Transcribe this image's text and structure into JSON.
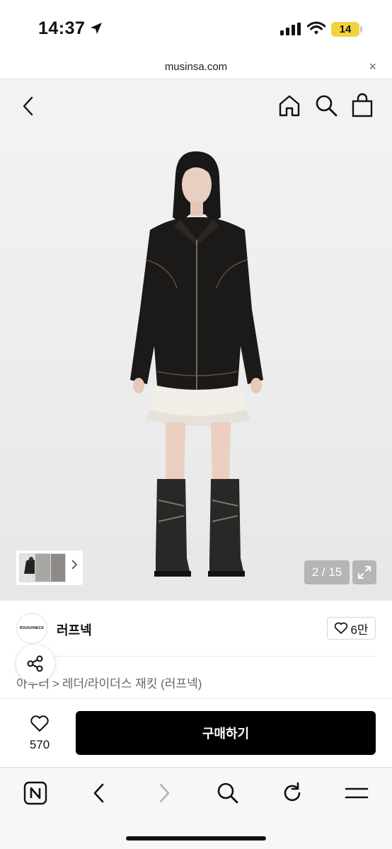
{
  "status": {
    "time": "14:37",
    "battery": "14"
  },
  "browser": {
    "url": "musinsa.com",
    "close_label": "×"
  },
  "gallery": {
    "counter": "2 / 15"
  },
  "brand": {
    "logo_text": "ROUGHNECK",
    "name": "러프넥",
    "like_count": "6만"
  },
  "breadcrumb": {
    "category": "아우터",
    "subcategory": "레더/라이더스 재킷 (러프넥)",
    "separator": ">"
  },
  "purchase": {
    "wish_count": "570",
    "buy_label": "구매하기"
  },
  "colors": {
    "buy_button": "#000000",
    "battery": "#f2d33d",
    "jacket": "#1c1a18"
  },
  "icons": [
    "back-chevron-icon",
    "home-icon",
    "search-icon",
    "shopping-bag-icon",
    "share-icon",
    "heart-icon",
    "naver-icon",
    "refresh-icon",
    "menu-icon",
    "expand-icon"
  ]
}
